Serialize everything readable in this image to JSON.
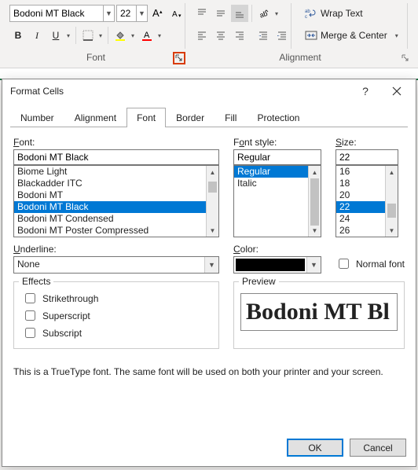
{
  "ribbon": {
    "font_name": "Bodoni MT Black",
    "font_size": "22",
    "group_font": "Font",
    "group_align": "Alignment",
    "wrap_text": "Wrap Text",
    "merge_center": "Merge & Center"
  },
  "dialog": {
    "title": "Format Cells",
    "tabs": [
      "Number",
      "Alignment",
      "Font",
      "Border",
      "Fill",
      "Protection"
    ],
    "active_tab": 2,
    "font_label": "Font:",
    "font_value": "Bodoni MT Black",
    "font_list": [
      "Biome Light",
      "Blackadder ITC",
      "Bodoni MT",
      "Bodoni MT Black",
      "Bodoni MT Condensed",
      "Bodoni MT Poster Compressed"
    ],
    "font_selected_index": 3,
    "style_label": "Font style:",
    "style_value": "Regular",
    "style_list": [
      "Regular",
      "Italic"
    ],
    "style_selected_index": 0,
    "size_label": "Size:",
    "size_value": "22",
    "size_list": [
      "16",
      "18",
      "20",
      "22",
      "24",
      "26"
    ],
    "size_selected_index": 3,
    "underline_label": "Underline:",
    "underline_value": "None",
    "color_label": "Color:",
    "color_value": "#000000",
    "normal_font": "Normal font",
    "effects_label": "Effects",
    "effects": {
      "strikethrough": "Strikethrough",
      "superscript": "Superscript",
      "subscript": "Subscript"
    },
    "preview_label": "Preview",
    "preview_text": "Bodoni MT Bl",
    "note": "This is a TrueType font.  The same font will be used on both your printer and your screen.",
    "ok": "OK",
    "cancel": "Cancel"
  }
}
